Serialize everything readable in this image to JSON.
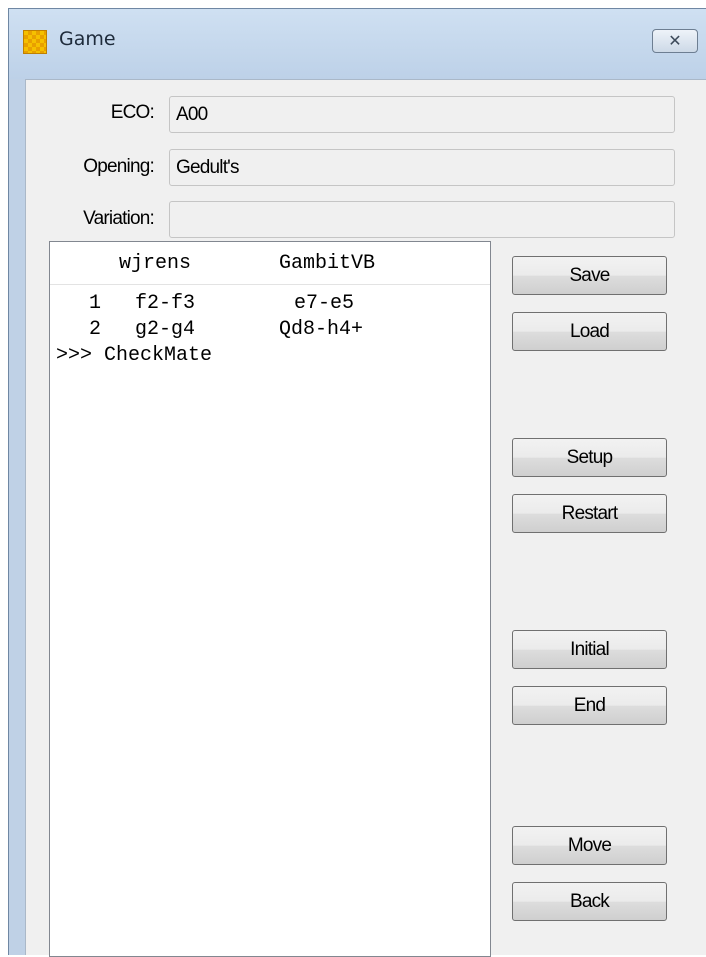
{
  "window": {
    "title": "Game",
    "close_glyph": "✕"
  },
  "fields": {
    "eco": {
      "label": "ECO:",
      "value": "A00"
    },
    "opening": {
      "label": "Opening:",
      "value": "Gedult's"
    },
    "variation": {
      "label": "Variation:",
      "value": ""
    }
  },
  "movelist": {
    "white_player": "wjrens",
    "black_player": "GambitVB",
    "moves": [
      {
        "number": "1",
        "white": "f2-f3",
        "black": "e7-e5"
      },
      {
        "number": "2",
        "white": "g2-g4",
        "black": "Qd8-h4+"
      }
    ],
    "result": ">>> CheckMate"
  },
  "buttons": {
    "save": "Save",
    "load": "Load",
    "setup": "Setup",
    "restart": "Restart",
    "initial": "Initial",
    "end": "End",
    "move": "Move",
    "back": "Back"
  }
}
